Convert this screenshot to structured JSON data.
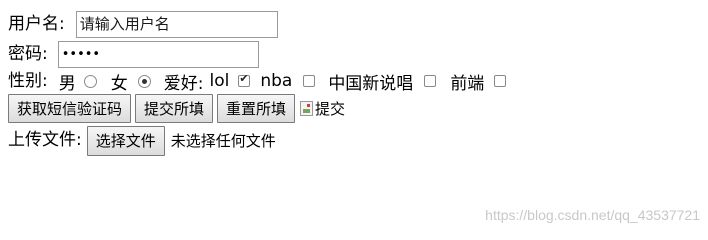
{
  "form": {
    "username": {
      "label": "用户名:",
      "value": "请输入用户名"
    },
    "password": {
      "label": "密码:",
      "value": "•••••"
    },
    "gender": {
      "label": "性别:",
      "options": [
        {
          "label": "男",
          "checked": false
        },
        {
          "label": "女",
          "checked": true
        }
      ]
    },
    "hobbies": {
      "label": "爱好:",
      "options": [
        {
          "label": "lol",
          "checked": true
        },
        {
          "label": "nba",
          "checked": false
        },
        {
          "label": "中国新说唱",
          "checked": false
        },
        {
          "label": "前端",
          "checked": false
        }
      ]
    },
    "buttons": {
      "get_code": "获取短信验证码",
      "submit": "提交所填",
      "reset": "重置所填",
      "image_submit_alt": "提交"
    },
    "upload": {
      "label": "上传文件:",
      "button": "选择文件",
      "status": "未选择任何文件"
    }
  },
  "watermark": "https://blog.csdn.net/qq_43537721"
}
